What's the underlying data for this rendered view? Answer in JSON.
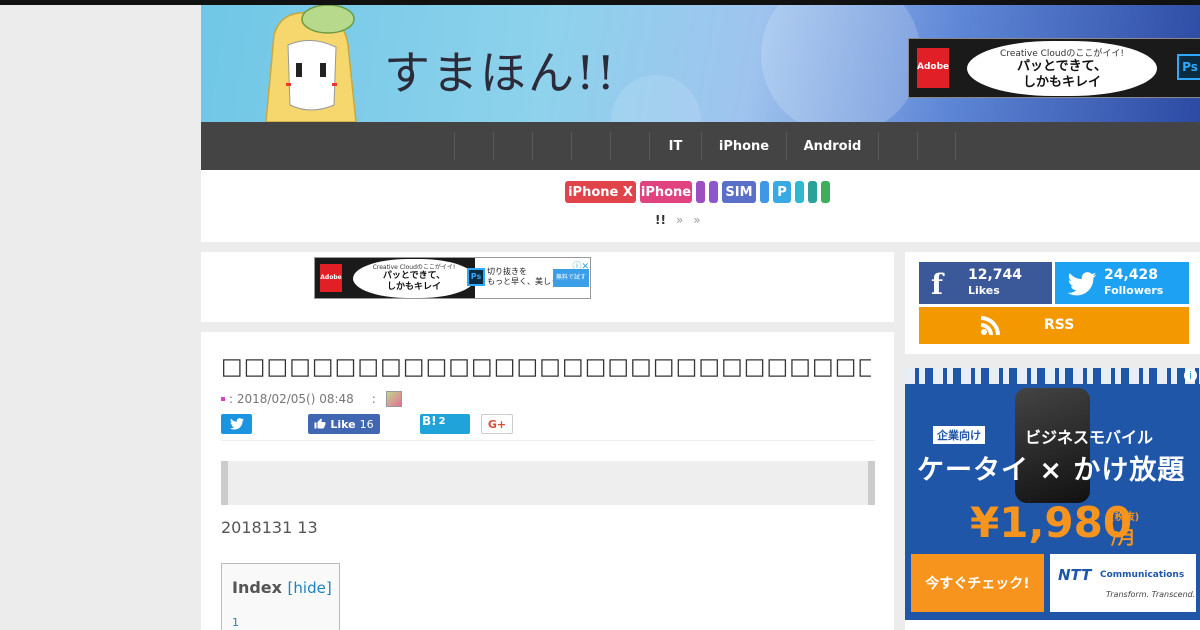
{
  "header": {
    "logo_text": "すまほん!!"
  },
  "header_ad": {
    "adobe_label": "Adobe",
    "cloud_small": "Creative Cloudのここがイイ!",
    "cloud_line1": "パッとできて、",
    "cloud_line2": "しかもキレイ",
    "ps_label": "Ps",
    "right_line1": "切り抜きを",
    "right_line2": "もっと早く、美しく",
    "cta": "無料で試す >",
    "close": "ⓘ✕"
  },
  "nav": {
    "items": [
      {
        "label": "",
        "width": 39
      },
      {
        "label": "",
        "width": 39
      },
      {
        "label": "",
        "width": 39
      },
      {
        "label": "",
        "width": 39
      },
      {
        "label": "",
        "width": 39
      },
      {
        "label": "IT",
        "width": 52
      },
      {
        "label": "iPhone",
        "width": 85
      },
      {
        "label": "Android",
        "width": 92
      },
      {
        "label": "",
        "width": 39
      },
      {
        "label": "",
        "width": 39
      }
    ]
  },
  "tags": [
    {
      "label": "iPhone X",
      "color": "#e0434a",
      "width": 71
    },
    {
      "label": "iPhone",
      "color": "#e0437f",
      "width": 52
    },
    {
      "label": "",
      "color": "#9b4fc0",
      "width": 9
    },
    {
      "label": "",
      "color": "#8a58c9",
      "width": 9
    },
    {
      "label": "SIM",
      "color": "#5a6fc8",
      "width": 34
    },
    {
      "label": "",
      "color": "#3f97e6",
      "width": 9
    },
    {
      "label": "P",
      "color": "#38a9e3",
      "width": 18
    },
    {
      "label": "",
      "color": "#2fb8d0",
      "width": 9
    },
    {
      "label": "",
      "color": "#2aa19a",
      "width": 9
    },
    {
      "label": "",
      "color": "#3fae5a",
      "width": 9
    }
  ],
  "breadcrumb": {
    "home": "!!",
    "sep1": "»",
    "sep2": "»"
  },
  "article": {
    "title": "□□□□□□□□□□□□□□□□□□□□□□□□□□□□□□□□□□□□□□□□□□□□□□",
    "date": ": 2018/02/05() 08:48",
    "author_sep": ":",
    "share": {
      "fb_label": "Like",
      "fb_count": "16",
      "hb_label": "B!",
      "hb_count": "2",
      "gp_label": "G+"
    },
    "date_text": "2018131 13",
    "toc": {
      "head": "Index",
      "hide": "[hide]",
      "item1": "1"
    }
  },
  "sidebar": {
    "fb_icon": "f",
    "fb_count": "12,744",
    "fb_label": "Likes",
    "tw_count": "24,428",
    "tw_label": "Followers",
    "rss_label": "RSS"
  },
  "ntt_ad": {
    "sub": "企業向け",
    "sub2": "ビジネスモバイル",
    "big": "ケータイ × かけ放題",
    "price": "¥1,980",
    "tax": "(税抜)",
    "per": "/月",
    "cta": "今すぐチェック!",
    "logo_n": "NTT",
    "logo_c": "Communications",
    "tagline": "Transform. Transcend."
  }
}
